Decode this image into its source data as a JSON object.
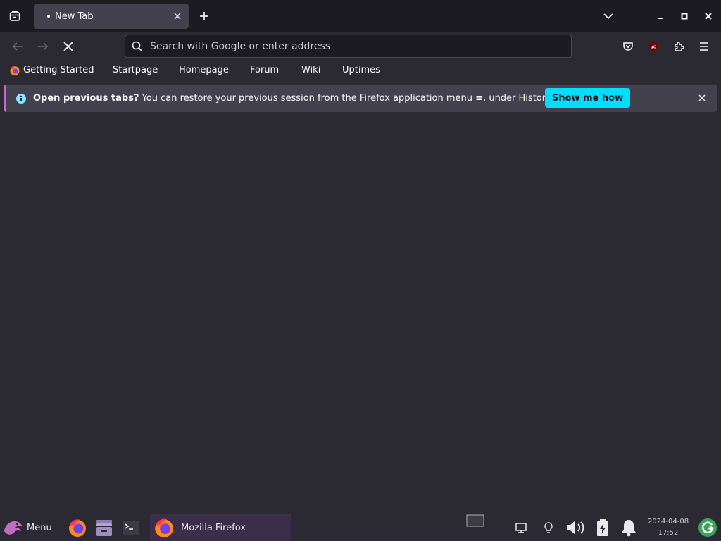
{
  "tabbar": {
    "tab_title": "New Tab",
    "icons": [
      "tab-list-icon",
      "close-icon",
      "plus-icon",
      "chevron-down-icon",
      "minimize-icon",
      "maximize-icon",
      "close-icon"
    ]
  },
  "navbar": {
    "search_placeholder": "Search with Google or enter address",
    "icons": [
      "back-arrow-icon",
      "forward-arrow-icon",
      "stop-icon",
      "search-icon",
      "pocket-icon",
      "ublock-icon",
      "extensions-icon",
      "hamburger-menu-icon"
    ]
  },
  "bookmarks": {
    "items": [
      {
        "label": "Getting Started",
        "icon": "firefox-icon"
      },
      {
        "label": "Startpage"
      },
      {
        "label": "Homepage"
      },
      {
        "label": "Forum"
      },
      {
        "label": "Wiki"
      },
      {
        "label": "Uptimes"
      }
    ]
  },
  "notice": {
    "title": "Open previous tabs?",
    "message": "You can restore your previous session from the Firefox application menu",
    "menu_glyph": "≡",
    "message_suffix": ", under History.",
    "button": "Show me how",
    "icons": [
      "info-icon",
      "close-icon"
    ]
  },
  "taskbar": {
    "menu_label": "Menu",
    "task_label": "Mozilla Firefox",
    "clock_date": "2024-04-08",
    "clock_time": "17:52",
    "icons": [
      "distro-logo-icon",
      "firefox-icon",
      "files-icon",
      "terminal-icon",
      "window-icon",
      "network-icon",
      "lightbulb-icon",
      "volume-icon",
      "battery-icon",
      "bell-icon",
      "update-icon"
    ]
  },
  "colors": {
    "accent": "#00ddff",
    "notice_stripe": "#c966d3",
    "background": "#2b2a33",
    "chrome_dark": "#1c1b22"
  }
}
